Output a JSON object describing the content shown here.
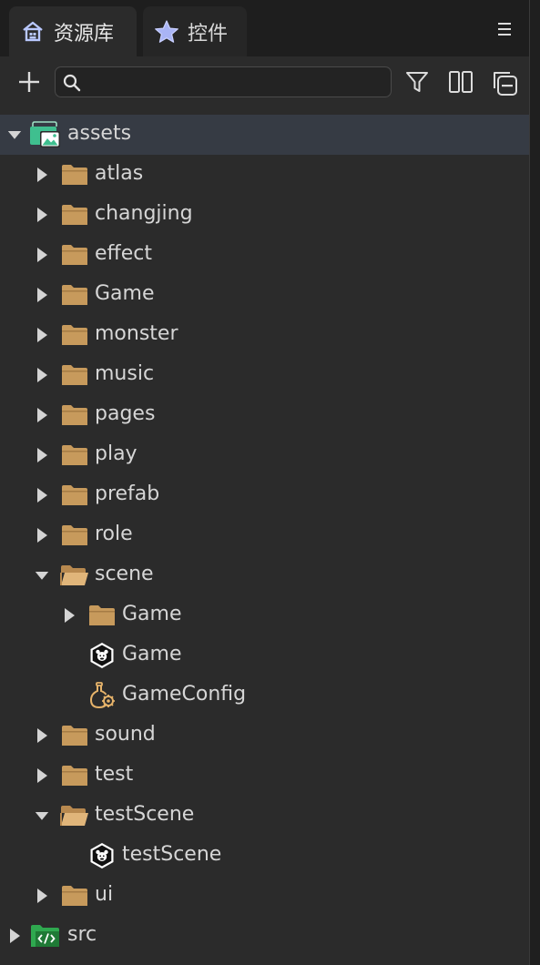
{
  "tabs": [
    {
      "label": "资源库",
      "icon": "asset-library-icon",
      "active": true
    },
    {
      "label": "控件",
      "icon": "star-icon",
      "active": false
    }
  ],
  "toolbar": {
    "add_icon": "plus-icon",
    "search_placeholder": "",
    "search_value": "",
    "filter_icon": "filter-icon",
    "split_view_icon": "split-view-icon",
    "collapse_icon": "collapse-all-icon"
  },
  "tree": [
    {
      "label": "assets",
      "depth": 0,
      "type": "assets-root",
      "expanded": true,
      "selected": true
    },
    {
      "label": "atlas",
      "depth": 1,
      "type": "folder",
      "expanded": false
    },
    {
      "label": "changjing",
      "depth": 1,
      "type": "folder",
      "expanded": false
    },
    {
      "label": "effect",
      "depth": 1,
      "type": "folder",
      "expanded": false
    },
    {
      "label": "Game",
      "depth": 1,
      "type": "folder",
      "expanded": false
    },
    {
      "label": "monster",
      "depth": 1,
      "type": "folder",
      "expanded": false
    },
    {
      "label": "music",
      "depth": 1,
      "type": "folder",
      "expanded": false
    },
    {
      "label": "pages",
      "depth": 1,
      "type": "folder",
      "expanded": false
    },
    {
      "label": "play",
      "depth": 1,
      "type": "folder",
      "expanded": false
    },
    {
      "label": "prefab",
      "depth": 1,
      "type": "folder",
      "expanded": false
    },
    {
      "label": "role",
      "depth": 1,
      "type": "folder",
      "expanded": false
    },
    {
      "label": "scene",
      "depth": 1,
      "type": "folder-open",
      "expanded": true
    },
    {
      "label": "Game",
      "depth": 2,
      "type": "folder",
      "expanded": false
    },
    {
      "label": "Game",
      "depth": 2,
      "type": "scene-file",
      "expanded": null
    },
    {
      "label": "GameConfig",
      "depth": 2,
      "type": "config-file",
      "expanded": null
    },
    {
      "label": "sound",
      "depth": 1,
      "type": "folder",
      "expanded": false
    },
    {
      "label": "test",
      "depth": 1,
      "type": "folder",
      "expanded": false
    },
    {
      "label": "testScene",
      "depth": 1,
      "type": "folder-open",
      "expanded": true
    },
    {
      "label": "testScene",
      "depth": 2,
      "type": "scene-file",
      "expanded": null
    },
    {
      "label": "ui",
      "depth": 1,
      "type": "folder",
      "expanded": false
    },
    {
      "label": "src",
      "depth": 0,
      "type": "src-root",
      "expanded": false
    }
  ],
  "colors": {
    "folder": "#c79a5c",
    "selected_row": "#363b44",
    "assets_icon": "#3fbf8f",
    "src_icon": "#2fa84f"
  }
}
